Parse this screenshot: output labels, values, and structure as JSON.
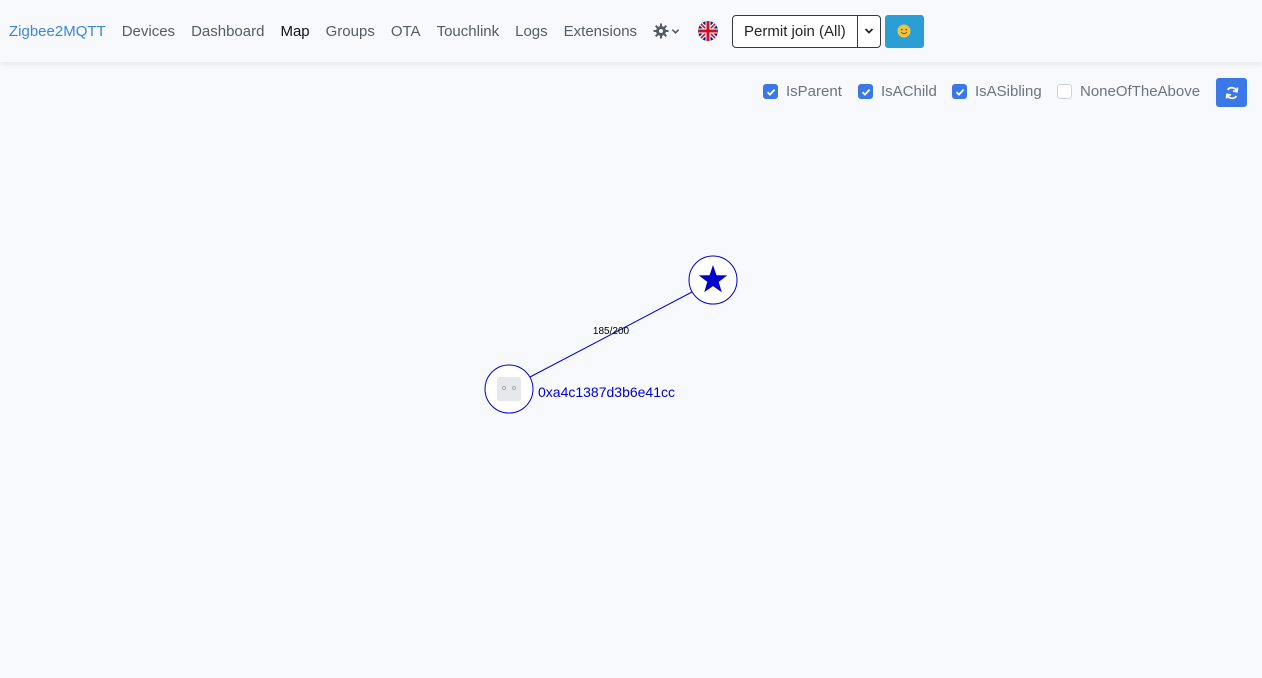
{
  "nav": {
    "brand": "Zigbee2MQTT",
    "links": [
      "Devices",
      "Dashboard",
      "Map",
      "Groups",
      "OTA",
      "Touchlink",
      "Logs",
      "Extensions"
    ],
    "active": "Map",
    "settings_icon": "gear-icon",
    "language_icon": "uk-flag-icon",
    "permit_join_label": "Permit join (All)",
    "theme_icon": "smiley-sun-icon",
    "theme_color": "#2a9fd6"
  },
  "filters": {
    "items": [
      {
        "label": "IsParent",
        "checked": true
      },
      {
        "label": "IsAChild",
        "checked": true
      },
      {
        "label": "IsASibling",
        "checked": true
      },
      {
        "label": "NoneOfTheAbove",
        "checked": false
      }
    ],
    "refresh_icon": "refresh-icon",
    "accent": "#3b78e7"
  },
  "map": {
    "link_label": "185/200",
    "coordinator_icon": "star-icon",
    "device_label": "0xa4c1387d3b6e41cc",
    "device_icon": "device-image-icon",
    "link_color": "#0000cc"
  }
}
